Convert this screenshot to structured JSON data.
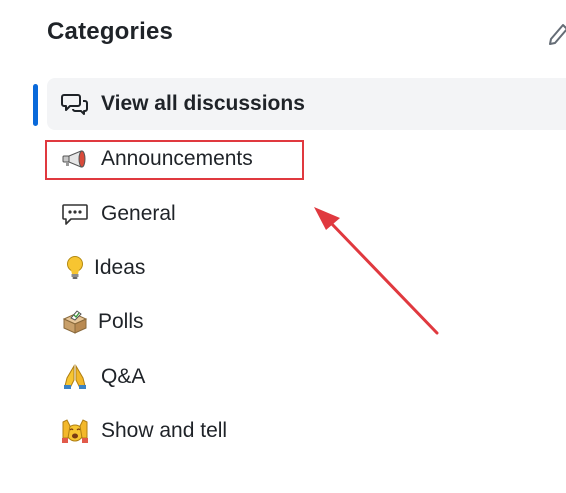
{
  "header": {
    "title": "Categories"
  },
  "categories": [
    {
      "label": "View all discussions",
      "icon": "discussions-icon",
      "selected": true
    },
    {
      "label": "Announcements",
      "icon": "megaphone-icon"
    },
    {
      "label": "General",
      "icon": "speech-balloon-icon"
    },
    {
      "label": "Ideas",
      "icon": "light-bulb-icon"
    },
    {
      "label": "Polls",
      "icon": "ballot-box-icon"
    },
    {
      "label": "Q&A",
      "icon": "folded-hands-icon"
    },
    {
      "label": "Show and tell",
      "icon": "raising-hands-icon"
    }
  ],
  "annotation": {
    "highlight_color": "#e0393f",
    "arrow_color": "#e0393f"
  },
  "colors": {
    "selected_indicator": "#0969da",
    "selected_background": "#f3f4f6",
    "text": "#1f2328"
  }
}
